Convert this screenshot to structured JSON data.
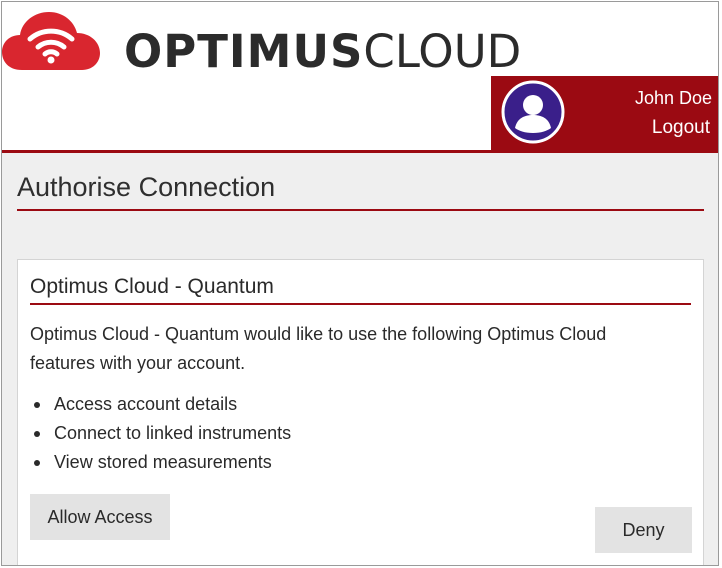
{
  "brand": {
    "name_bold": "OPTIMUS",
    "name_light": "CLOUD",
    "logo_icon": "cloud-wifi-icon",
    "accent_color": "#9b0a12"
  },
  "user": {
    "name": "John Doe",
    "logout_label": "Logout",
    "avatar_icon": "user-avatar-icon"
  },
  "page": {
    "title": "Authorise Connection"
  },
  "card": {
    "title": "Optimus Cloud - Quantum",
    "description": "Optimus Cloud - Quantum would like to use the following Optimus Cloud features with your account.",
    "features": [
      "Access account details",
      "Connect to linked instruments",
      "View stored measurements"
    ],
    "allow_label": "Allow Access",
    "deny_label": "Deny"
  }
}
